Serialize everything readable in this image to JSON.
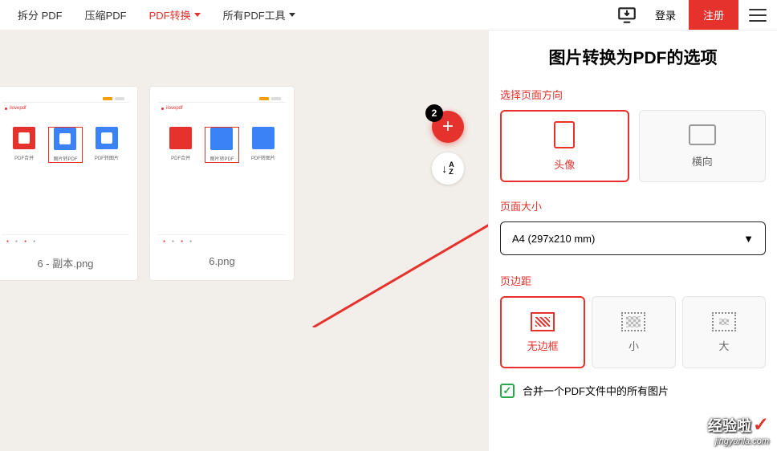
{
  "header": {
    "nav": {
      "split": "拆分 PDF",
      "compress": "压缩PDF",
      "convert": "PDF转换",
      "all_tools": "所有PDF工具"
    },
    "login": "登录",
    "register": "注册"
  },
  "left": {
    "thumbs": [
      {
        "label": "6 - 副本.png"
      },
      {
        "label": "6.png"
      }
    ],
    "fab_badge": "2"
  },
  "panel": {
    "title": "图片转换为PDF的选项",
    "orientation": {
      "section": "选择页面方向",
      "portrait": "头像",
      "landscape": "横向"
    },
    "page_size": {
      "section": "页面大小",
      "value": "A4 (297x210 mm)"
    },
    "margin": {
      "section": "页边距",
      "none": "无边框",
      "small": "小",
      "large": "大"
    },
    "merge_label": "合并一个PDF文件中的所有图片"
  },
  "watermark": {
    "brand": "经验啦",
    "url": "jingyanla.com"
  }
}
